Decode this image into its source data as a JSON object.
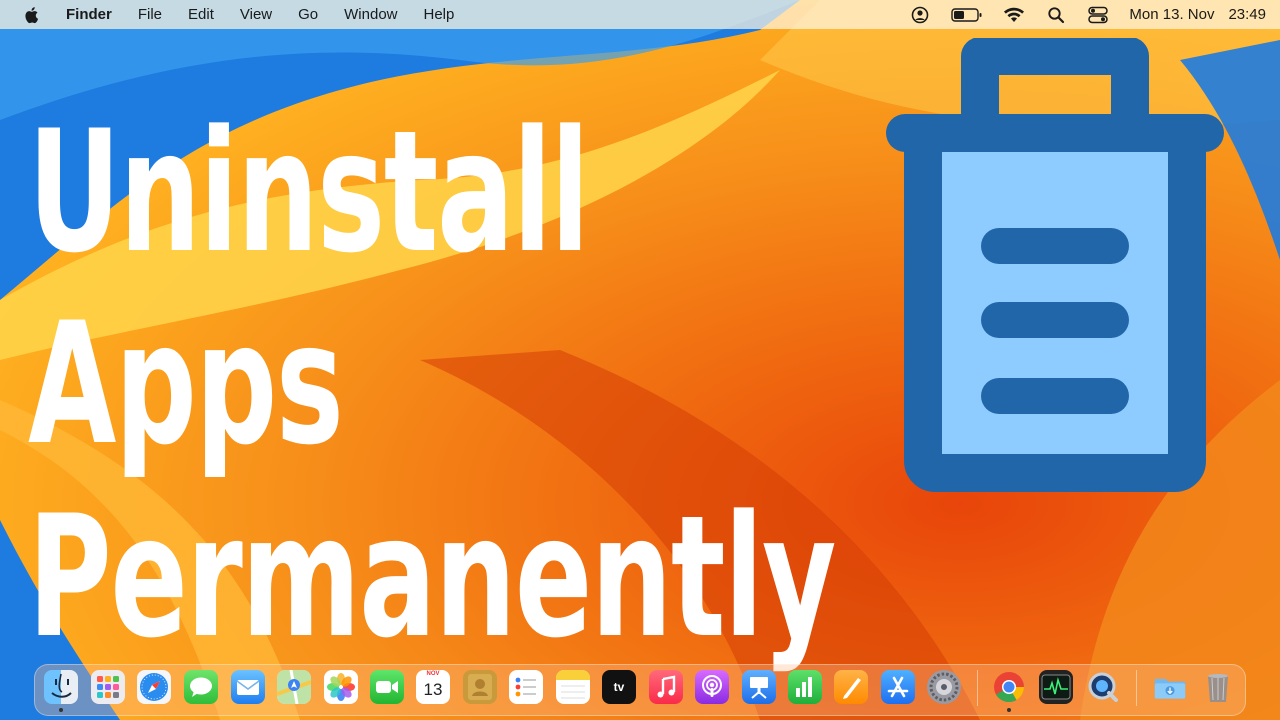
{
  "menubar": {
    "app_name": "Finder",
    "items": [
      "File",
      "Edit",
      "View",
      "Go",
      "Window",
      "Help"
    ],
    "date": "Mon 13. Nov",
    "time": "23:49"
  },
  "headline": {
    "line1": "Uninstall",
    "line2": "Apps",
    "line3": "Permanently"
  },
  "trash_icon": {
    "outline_color": "#2266aa",
    "fill_color": "#8ecbff"
  },
  "dock": {
    "calendar_month": "NOV",
    "calendar_day": "13",
    "tv_label": "tv",
    "apps": [
      "finder-icon",
      "launchpad-icon",
      "safari-icon",
      "messages-icon",
      "mail-icon",
      "maps-icon",
      "photos-icon",
      "facetime-icon",
      "calendar-icon",
      "contacts-icon",
      "reminders-icon",
      "notes-icon",
      "apple-tv-icon",
      "music-icon",
      "podcasts-icon",
      "keynote-icon",
      "numbers-icon",
      "pages-icon",
      "app-store-icon",
      "system-settings-icon",
      "chrome-icon",
      "activity-monitor-icon",
      "quicktime-icon",
      "downloads-folder-icon",
      "trash-icon"
    ]
  }
}
